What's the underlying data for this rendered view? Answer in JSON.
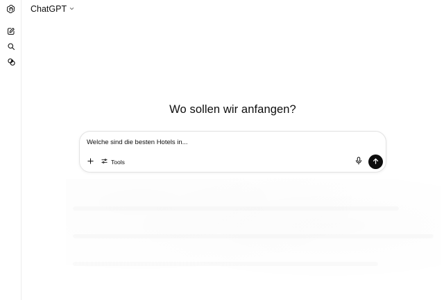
{
  "header": {
    "model_name": "ChatGPT",
    "model_chevron_icon": "chevron-down-icon"
  },
  "sidebar": {
    "items": [
      {
        "name": "openai-logo-icon"
      },
      {
        "name": "new-chat-icon"
      },
      {
        "name": "search-icon"
      },
      {
        "name": "library-icon"
      }
    ]
  },
  "main": {
    "heading": "Wo sollen wir anfangen?"
  },
  "composer": {
    "input_value": "Welche sind die besten Hotels in...",
    "add_icon": "plus-icon",
    "tools_label": "Tools",
    "tools_icon": "sliders-icon",
    "mic_icon": "microphone-icon",
    "send_icon": "arrow-up-icon"
  },
  "colors": {
    "text": "#0d0d0d",
    "background": "#ffffff",
    "send_button": "#0d0d0d",
    "border": "#e3e3e3"
  }
}
